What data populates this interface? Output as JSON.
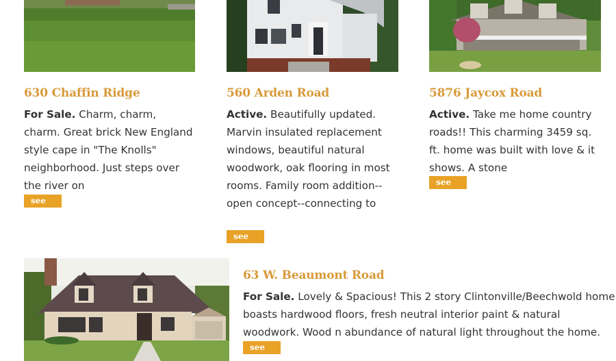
{
  "listings": [
    {
      "title": "630 Chaffin Ridge",
      "status": "For Sale.",
      "description": " Charm, charm, charm. Great brick New England style cape in \"The Knolls\" neighborhood. Just steps over the river on",
      "link": "see more"
    },
    {
      "title": "560 Arden Road",
      "status": "Active.",
      "description": " Beautifully updated. Marvin insulated replacement windows, beautiful natural woodwork, oak flooring in most rooms. Family room addition--open concept--connecting to",
      "link": "see more"
    },
    {
      "title": "5876 Jaycox Road",
      "status": "Active.",
      "description": " Take me home country roads!! This charming 3459 sq. ft. home was built with love & it shows. A stone",
      "link": "see more"
    },
    {
      "title": "63 W. Beaumont Road",
      "status": "For Sale.",
      "description": " Lovely & Spacious! This 2 story Clintonville/Beechwold home boasts hardwood floors, fresh neutral interior paint & natural woodwork. Wood n abundance of natural light throughout the home. Living room has wood b",
      "link": "see more"
    }
  ],
  "colors": {
    "title": "#d89a3a",
    "button": "#e8a226",
    "text": "#333333"
  }
}
